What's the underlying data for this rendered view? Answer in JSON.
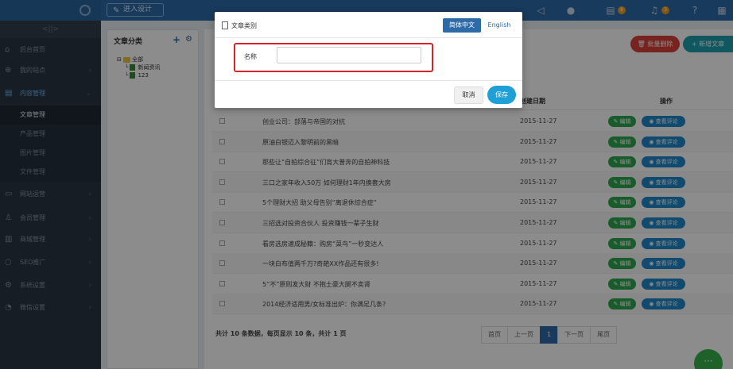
{
  "topbar": {
    "design_button": "进入设计",
    "badges": {
      "notifications": "3",
      "messages": "8"
    }
  },
  "sidebar": {
    "toggle": "<||>",
    "items": [
      {
        "label": "后台首页",
        "icon": "home-icon"
      },
      {
        "label": "我的站点",
        "icon": "globe-icon"
      },
      {
        "label": "内容管理",
        "icon": "document-icon"
      },
      {
        "label": "网站运营",
        "icon": "monitor-icon"
      },
      {
        "label": "会员管理",
        "icon": "users-icon"
      },
      {
        "label": "商城管理",
        "icon": "store-icon"
      },
      {
        "label": "SEO推广",
        "icon": "search-icon"
      },
      {
        "label": "系统设置",
        "icon": "gear-icon"
      },
      {
        "label": "微信设置",
        "icon": "wechat-icon"
      }
    ],
    "subitems": [
      "文章管理",
      "产品管理",
      "图片管理",
      "文件管理"
    ]
  },
  "category": {
    "title": "文章分类",
    "tree": {
      "root": "全部",
      "children": [
        "新闻资讯",
        "123"
      ]
    }
  },
  "toolbar": {
    "bulk_delete": "批量删除",
    "add_article": "新增文章"
  },
  "table": {
    "headers": {
      "date": "创建日期",
      "actions": "操作"
    },
    "edit_label": "编辑",
    "comments_label": "查看评论",
    "rows": [
      {
        "title": "创业公司：部落与帝国的对抗",
        "date": "2015-11-27"
      },
      {
        "title": "原油白银迈入黎明前的黑暗",
        "date": "2015-11-27"
      },
      {
        "title": "那些让“自拍综合征”们肓大普奔的自拍神科技",
        "date": "2015-11-27"
      },
      {
        "title": "三口之家年收入50万 如何理财1年内换套大房",
        "date": "2015-11-27"
      },
      {
        "title": "5个理财大招 助父母告别“离退休综合症”",
        "date": "2015-11-27"
      },
      {
        "title": "三招选对投资合伙人 投资赚钱一辈子生财",
        "date": "2015-11-27"
      },
      {
        "title": "看房选房速成秘籍：购房“菜鸟”一秒变达人",
        "date": "2015-11-27"
      },
      {
        "title": "一块白布值两千万?奇葩XX作品还有很多!",
        "date": "2015-11-27"
      },
      {
        "title": "5“不”原则发大财 不抱土豪大腿不卖肾",
        "date": "2015-11-27"
      },
      {
        "title": "2014经济适用男/女标准出炉：你满足几条?",
        "date": "2015-11-27"
      }
    ]
  },
  "footer": {
    "summary": "共计 10 条数据，每页显示 10 条，共计 1 页",
    "pager": {
      "first": "首页",
      "prev": "上一页",
      "current": "1",
      "next": "下一页",
      "last": "尾页"
    }
  },
  "dialog": {
    "title": "文章类别",
    "lang_zh": "简体中文",
    "lang_en": "English",
    "name_label": "名称",
    "name_value": "",
    "cancel": "取消",
    "save": "保存"
  },
  "colors": {
    "brand": "#2d6aa8",
    "sidebar": "#2b3542",
    "danger": "#d9413a",
    "teal": "#1e9fb0",
    "edit_green": "#2fa84f",
    "comment_blue": "#1e88c8",
    "highlight_red": "#d8232a"
  }
}
